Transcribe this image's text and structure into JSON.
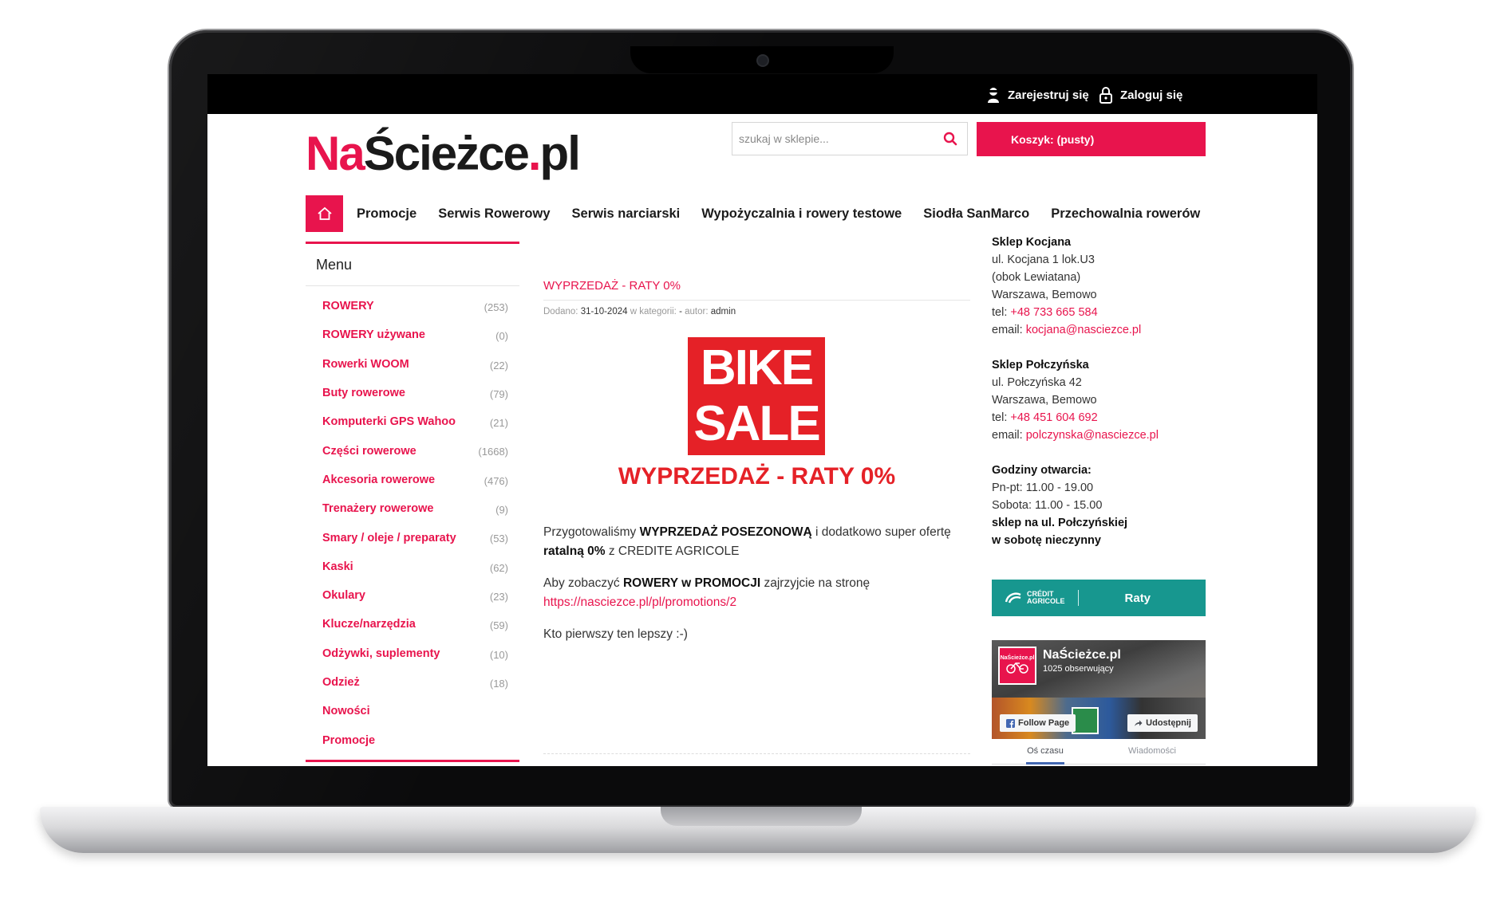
{
  "topbar": {
    "register_label": "Zarejestruj się",
    "login_label": "Zaloguj się"
  },
  "header": {
    "logo_part1": "Na",
    "logo_part2": "Ścieżce",
    "logo_dot": ".",
    "logo_part3": "pl",
    "search_placeholder": "szukaj w sklepie...",
    "cart_label": "Koszyk: (pusty)"
  },
  "nav": {
    "items": [
      {
        "label": "Promocje"
      },
      {
        "label": "Serwis Rowerowy"
      },
      {
        "label": "Serwis narciarski"
      },
      {
        "label": "Wypożyczalnia i rowery testowe"
      },
      {
        "label": "Siodła SanMarco"
      },
      {
        "label": "Przechowalnia rowerów"
      }
    ]
  },
  "sidebar": {
    "title": "Menu",
    "categories": [
      {
        "label": "ROWERY",
        "count": "(253)"
      },
      {
        "label": "ROWERY używane",
        "count": "(0)"
      },
      {
        "label": "Rowerki WOOM",
        "count": "(22)"
      },
      {
        "label": "Buty rowerowe",
        "count": "(79)"
      },
      {
        "label": "Komputerki GPS Wahoo",
        "count": "(21)"
      },
      {
        "label": "Części rowerowe",
        "count": "(1668)"
      },
      {
        "label": "Akcesoria rowerowe",
        "count": "(476)"
      },
      {
        "label": "Trenażery rowerowe",
        "count": "(9)"
      },
      {
        "label": "Smary / oleje / preparaty",
        "count": "(53)"
      },
      {
        "label": "Kaski",
        "count": "(62)"
      },
      {
        "label": "Okulary",
        "count": "(23)"
      },
      {
        "label": "Klucze/narzędzia",
        "count": "(59)"
      },
      {
        "label": "Odżywki, suplementy",
        "count": "(10)"
      },
      {
        "label": "Odzież",
        "count": "(18)"
      },
      {
        "label": "Nowości",
        "count": ""
      },
      {
        "label": "Promocje",
        "count": ""
      }
    ]
  },
  "post": {
    "title": "WYPRZEDAŻ - RATY 0%",
    "meta_added_label": "Dodano:",
    "meta_date": "31-10-2024",
    "meta_category_label": "w kategorii:",
    "meta_sep": "-",
    "meta_author_label": "autor:",
    "meta_author": "admin",
    "banner_line1": "BIKE",
    "banner_line2": "SALE",
    "banner_subtitle": "WYPRZEDAŻ - RATY 0%",
    "p1_a": "Przygotowaliśmy ",
    "p1_b": "WYPRZEDAŻ POSEZONOWĄ",
    "p1_c": "  i dodatkowo super ofertę ",
    "p1_d": "ratalną 0%",
    "p1_e": " z CREDITE AGRICOLE",
    "p2_a": "Aby zobaczyć ",
    "p2_b": "ROWERY w PROMOCJI",
    "p2_c": " zajrzyjcie na stronę ",
    "p2_link": "https://nasciezce.pl/pl/promotions/2",
    "p3": "Kto pierwszy ten lepszy :-)"
  },
  "stores": [
    {
      "name": "Sklep Kocjana",
      "address1": "ul. Kocjana 1 lok.U3",
      "address2": "(obok Lewiatana)",
      "city": "Warszawa, Bemowo",
      "tel_label": "tel: ",
      "tel": "+48 733 665 584",
      "email_label": "email: ",
      "email": "kocjana@nasciezce.pl"
    },
    {
      "name": "Sklep Połczyńska",
      "address1": "ul. Połczyńska 42",
      "city": "Warszawa, Bemowo",
      "tel_label": "tel: ",
      "tel": "+48 451 604 692",
      "email_label": "email: ",
      "email": "polczynska@nasciezce.pl"
    }
  ],
  "hours": {
    "title": "Godziny otwarcia:",
    "weekdays": "Pn-pt: 11.00 - 19.00",
    "saturday": "Sobota: 11.00 - 15.00",
    "note1": "sklep na ul. Połczyńskiej",
    "note2": "w sobotę nieczynny"
  },
  "raty_banner": {
    "brand_line1": "CRÉDIT",
    "brand_line2": "AGRICOLE",
    "label": "Raty"
  },
  "facebook": {
    "avatar_text": "NaŚcieżce.pl",
    "page_name": "NaŚcieżce.pl",
    "followers": "1025 obserwujący",
    "follow_label": "Follow Page",
    "share_label": "Udostępnij",
    "tab1": "Oś czasu",
    "tab2": "Wiadomości"
  },
  "colors": {
    "accent": "#e8144d",
    "sale_red": "#e52127",
    "teal": "#17978f"
  }
}
